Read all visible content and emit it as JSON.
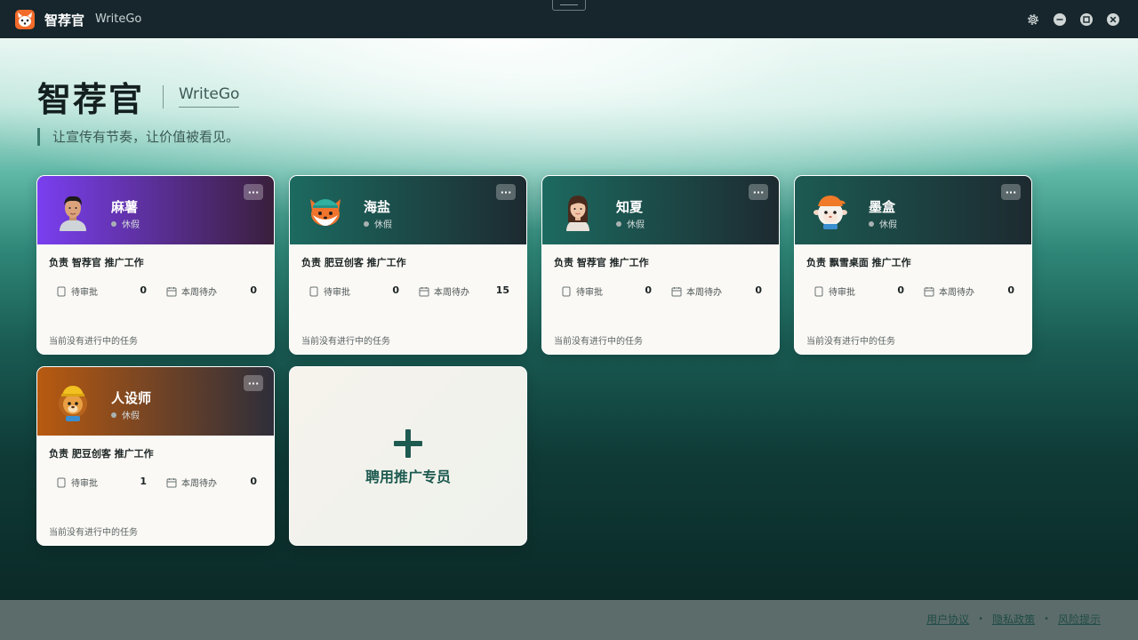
{
  "titlebar": {
    "app_name": "智荐官",
    "app_sub": "WriteGo",
    "icons": [
      "settings-icon",
      "minimize-icon",
      "maximize-icon",
      "close-icon"
    ]
  },
  "hero": {
    "title": "智荐官",
    "subtitle": "WriteGo",
    "tagline": "让宣传有节奏，让价值被看见。"
  },
  "cards": [
    {
      "name": "麻薯",
      "status": "休假",
      "duty": "负责 智荐官 推广工作",
      "pending_label": "待审批",
      "pending_value": "0",
      "week_label": "本周待办",
      "week_value": "0",
      "footer": "当前没有进行中的任务",
      "more": "···",
      "header_from": "#7a3ff0",
      "header_to": "#3a1f3c",
      "avatar": "man-avatar"
    },
    {
      "name": "海盐",
      "status": "休假",
      "duty": "负责 肥豆创客 推广工作",
      "pending_label": "待审批",
      "pending_value": "0",
      "week_label": "本周待办",
      "week_value": "15",
      "footer": "当前没有进行中的任务",
      "more": "···",
      "header_from": "#1c6a60",
      "header_to": "#1d2a30",
      "avatar": "fox-avatar"
    },
    {
      "name": "知夏",
      "status": "休假",
      "duty": "负责 智荐官 推广工作",
      "pending_label": "待审批",
      "pending_value": "0",
      "week_label": "本周待办",
      "week_value": "0",
      "footer": "当前没有进行中的任务",
      "more": "···",
      "header_from": "#1c6a60",
      "header_to": "#1d2a30",
      "avatar": "woman-avatar"
    },
    {
      "name": "墨盒",
      "status": "休假",
      "duty": "负责 飘雪桌面 推广工作",
      "pending_label": "待审批",
      "pending_value": "0",
      "week_label": "本周待办",
      "week_value": "0",
      "footer": "当前没有进行中的任务",
      "more": "···",
      "header_from": "#1c5a52",
      "header_to": "#1d2a30",
      "avatar": "sheep-avatar"
    },
    {
      "name": "人设师",
      "status": "休假",
      "duty": "负责 肥豆创客 推广工作",
      "pending_label": "待审批",
      "pending_value": "1",
      "week_label": "本周待办",
      "week_value": "0",
      "footer": "当前没有进行中的任务",
      "more": "···",
      "header_from": "#b85a10",
      "header_to": "#2e2e3a",
      "avatar": "lion-avatar"
    }
  ],
  "hire": {
    "label": "聘用推广专员"
  },
  "footer": {
    "links": [
      "用户协议",
      "隐私政策",
      "风险提示"
    ],
    "separator": "•"
  }
}
